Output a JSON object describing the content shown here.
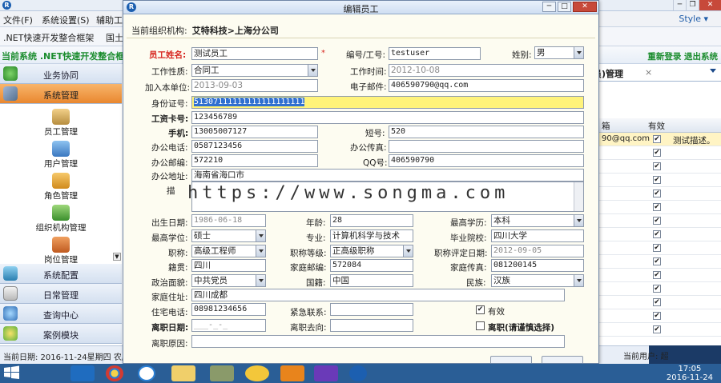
{
  "background": {
    "menu": [
      "文件(F)",
      "系统设置(S)",
      "辅助工"
    ],
    "style_label": "Style ▾",
    "toolbar_text": ".NET快速开发整合框架",
    "toolbar_text2": "国土",
    "banner_left": "当前系统 .NET快速开发整合框",
    "banner_right": "重新登录 退出系统",
    "status_left": "当前日期: 2016-11-24星期四 农历",
    "status_right": "当前用户: 超"
  },
  "sidebar": {
    "sections": [
      {
        "label": "业务协同",
        "icon": "network-icon"
      },
      {
        "label": "系统管理",
        "icon": "wrench-icon"
      }
    ],
    "items": [
      {
        "label": "员工管理",
        "icon": "employee-icon"
      },
      {
        "label": "用户管理",
        "icon": "user-icon"
      },
      {
        "label": "角色管理",
        "icon": "role-icon"
      },
      {
        "label": "组织机构管理",
        "icon": "org-icon"
      },
      {
        "label": "岗位管理",
        "icon": "post-icon"
      }
    ],
    "bottom_sections": [
      {
        "label": "系统配置",
        "icon": "config-icon"
      },
      {
        "label": "日常管理",
        "icon": "calendar-icon"
      },
      {
        "label": "查询中心",
        "icon": "search-icon"
      },
      {
        "label": "案例模块",
        "icon": "flower-icon"
      }
    ]
  },
  "right_grid": {
    "tab_title": "员)管理",
    "tab_close": "×",
    "columns": [
      "箱",
      "有效"
    ],
    "rows": [
      {
        "email": "90@qq.com",
        "valid": "✔",
        "desc": "测试描述。"
      },
      {
        "valid": "✔"
      },
      {
        "valid": "✔"
      },
      {
        "valid": "✔"
      },
      {
        "valid": "✔"
      },
      {
        "valid": "✔"
      },
      {
        "valid": "✔"
      },
      {
        "valid": "✔"
      },
      {
        "valid": "✔"
      },
      {
        "valid": "✔"
      },
      {
        "valid": "✔"
      },
      {
        "valid": "✔"
      },
      {
        "valid": "✔"
      },
      {
        "valid": "✔"
      },
      {
        "valid": "✔"
      }
    ]
  },
  "dialog": {
    "title": "编辑员工",
    "org_label": "当前组织机构:",
    "org_value": "艾特科技>上海分公司",
    "fields": {
      "name_label": "员工姓名:",
      "name": "测试员工",
      "code_label": "编号/工号:",
      "code": "testuser",
      "gender_label": "姓别:",
      "gender": "男",
      "worktype_label": "工作性质:",
      "worktype": "合同工",
      "worktime_label": "工作时间:",
      "worktime": "2012-10-08",
      "joindate_label": "加入本单位:",
      "joindate": "2013-09-03",
      "email_label": "电子邮件:",
      "email": "406590790@qq.com",
      "idcard_label": "身份证号:",
      "idcard": "51307111111111111111111",
      "salary_label": "工资卡号:",
      "salary": "123456789",
      "mobile_label": "手机:",
      "mobile": "13005007127",
      "short_label": "短号:",
      "short": "520",
      "officetel_label": "办公电话:",
      "officetel": "0587123456",
      "officefax_label": "办公传真:",
      "officefax": "",
      "officezip_label": "办公邮编:",
      "officezip": "572210",
      "qq_label": "QQ号:",
      "qq": "406590790",
      "officeaddr_label": "办公地址:",
      "officeaddr": "海南省海口市",
      "desc_label": "描",
      "birth_label": "出生日期:",
      "birth": "1986-06-18",
      "age_label": "年龄:",
      "age": "28",
      "degree_label": "最高学历:",
      "degree": "本科",
      "edu_label": "最高学位:",
      "edu": "硕士",
      "major_label": "专业:",
      "major": "计算机科学与技术",
      "school_label": "毕业院校:",
      "school": "四川大学",
      "title_label": "职称:",
      "title": "高级工程师",
      "titlelevel_label": "职称等级:",
      "titlelevel": "正高级职称",
      "titledate_label": "职称评定日期:",
      "titledate": "2012-09-05",
      "native_label": "籍贯:",
      "native": "四川",
      "homezip_label": "家庭邮编:",
      "homezip": "572084",
      "homefax_label": "家庭传真:",
      "homefax": "081200145",
      "party_label": "政治面貌:",
      "party": "中共党员",
      "nation_label": "国籍:",
      "nation": "中国",
      "ethnic_label": "民族:",
      "ethnic": "汉族",
      "homeaddr_label": "家庭住址:",
      "homeaddr": "四川成都",
      "hometel_label": "住宅电话:",
      "hometel": "08981234656",
      "emergency_label": "紧急联系:",
      "emergency": "",
      "valid_label": "有效",
      "leavedate_label": "离职日期:",
      "leavedate": "___-_-_",
      "leaveto_label": "离职去向:",
      "leaveto": "",
      "leave_label": "离职(请谨慎选择)",
      "leavereason_label": "离职原因:",
      "leavereason": ""
    },
    "watermark": "https://www.songma.com"
  },
  "taskbar": {
    "time": "17:05",
    "date": "2016-11-24"
  }
}
